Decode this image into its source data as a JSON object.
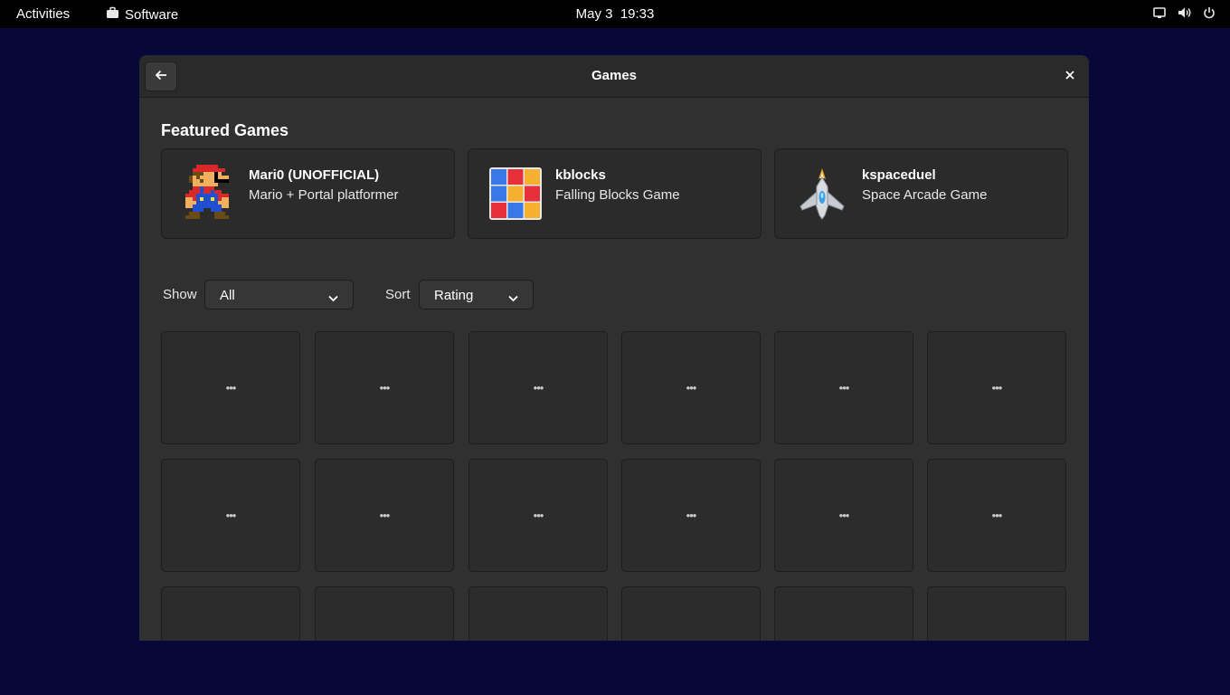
{
  "topbar": {
    "activities": "Activities",
    "app_name": "Software",
    "clock_date": "May 3",
    "clock_time": "19:33",
    "status_icons": [
      "screen-icon",
      "volume-icon",
      "power-icon"
    ]
  },
  "window": {
    "title": "Games"
  },
  "featured": {
    "heading": "Featured Games",
    "items": [
      {
        "name": "Mari0 (UNOFFICIAL)",
        "summary": "Mario + Portal platformer",
        "icon": "mario-icon"
      },
      {
        "name": "kblocks",
        "summary": "Falling Blocks Game",
        "icon": "kblocks-icon"
      },
      {
        "name": "kspaceduel",
        "summary": "Space Arcade Game",
        "icon": "kspaceduel-icon"
      }
    ]
  },
  "filters": {
    "show_label": "Show",
    "show_value": "All",
    "sort_label": "Sort",
    "sort_value": "Rating"
  },
  "grid": {
    "placeholder": "•••"
  },
  "colors": {
    "desktop": "#07073a",
    "window_bg": "#303030",
    "headerbar": "#2a2a2a",
    "tile": "#2c2c2c"
  }
}
